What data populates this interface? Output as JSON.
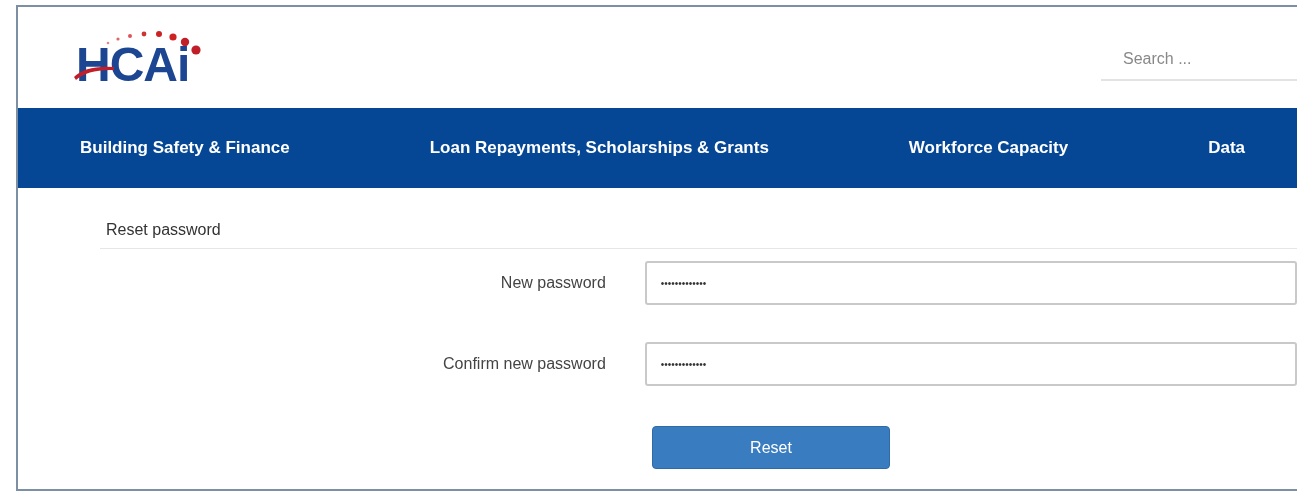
{
  "logo": {
    "text": "HCAi"
  },
  "search": {
    "placeholder": "Search ..."
  },
  "nav": [
    {
      "label": "Building Safety & Finance"
    },
    {
      "label": "Loan Repayments, Scholarships & Grants"
    },
    {
      "label": "Workforce Capacity"
    },
    {
      "label": "Data"
    }
  ],
  "form": {
    "title": "Reset password",
    "fields": [
      {
        "label": "New password",
        "value": "•••••••••••••"
      },
      {
        "label": "Confirm new password",
        "value": "•••••••••••••"
      }
    ],
    "button": "Reset"
  }
}
